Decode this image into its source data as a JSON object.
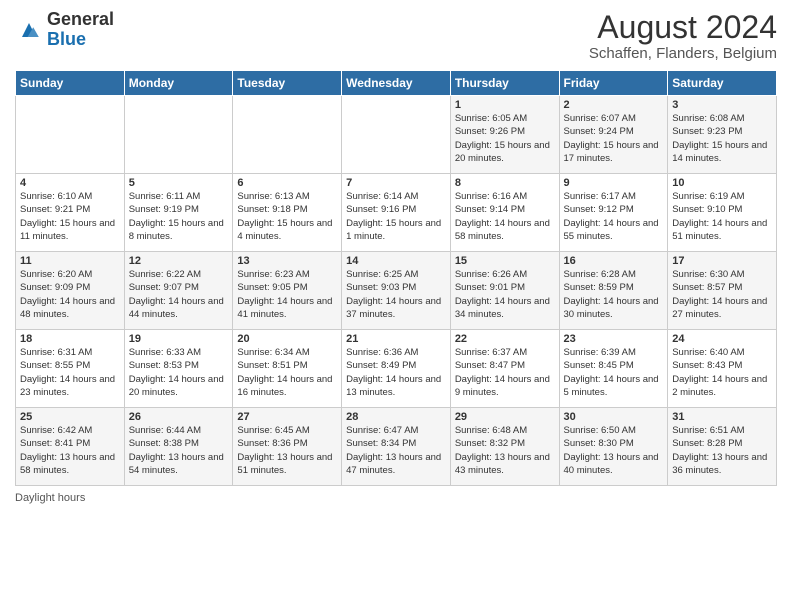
{
  "header": {
    "logo_general": "General",
    "logo_blue": "Blue",
    "month_year": "August 2024",
    "location": "Schaffen, Flanders, Belgium"
  },
  "days_of_week": [
    "Sunday",
    "Monday",
    "Tuesday",
    "Wednesday",
    "Thursday",
    "Friday",
    "Saturday"
  ],
  "weeks": [
    [
      {
        "day": "",
        "sunrise": "",
        "sunset": "",
        "daylight": ""
      },
      {
        "day": "",
        "sunrise": "",
        "sunset": "",
        "daylight": ""
      },
      {
        "day": "",
        "sunrise": "",
        "sunset": "",
        "daylight": ""
      },
      {
        "day": "",
        "sunrise": "",
        "sunset": "",
        "daylight": ""
      },
      {
        "day": "1",
        "sunrise": "Sunrise: 6:05 AM",
        "sunset": "Sunset: 9:26 PM",
        "daylight": "Daylight: 15 hours and 20 minutes."
      },
      {
        "day": "2",
        "sunrise": "Sunrise: 6:07 AM",
        "sunset": "Sunset: 9:24 PM",
        "daylight": "Daylight: 15 hours and 17 minutes."
      },
      {
        "day": "3",
        "sunrise": "Sunrise: 6:08 AM",
        "sunset": "Sunset: 9:23 PM",
        "daylight": "Daylight: 15 hours and 14 minutes."
      }
    ],
    [
      {
        "day": "4",
        "sunrise": "Sunrise: 6:10 AM",
        "sunset": "Sunset: 9:21 PM",
        "daylight": "Daylight: 15 hours and 11 minutes."
      },
      {
        "day": "5",
        "sunrise": "Sunrise: 6:11 AM",
        "sunset": "Sunset: 9:19 PM",
        "daylight": "Daylight: 15 hours and 8 minutes."
      },
      {
        "day": "6",
        "sunrise": "Sunrise: 6:13 AM",
        "sunset": "Sunset: 9:18 PM",
        "daylight": "Daylight: 15 hours and 4 minutes."
      },
      {
        "day": "7",
        "sunrise": "Sunrise: 6:14 AM",
        "sunset": "Sunset: 9:16 PM",
        "daylight": "Daylight: 15 hours and 1 minute."
      },
      {
        "day": "8",
        "sunrise": "Sunrise: 6:16 AM",
        "sunset": "Sunset: 9:14 PM",
        "daylight": "Daylight: 14 hours and 58 minutes."
      },
      {
        "day": "9",
        "sunrise": "Sunrise: 6:17 AM",
        "sunset": "Sunset: 9:12 PM",
        "daylight": "Daylight: 14 hours and 55 minutes."
      },
      {
        "day": "10",
        "sunrise": "Sunrise: 6:19 AM",
        "sunset": "Sunset: 9:10 PM",
        "daylight": "Daylight: 14 hours and 51 minutes."
      }
    ],
    [
      {
        "day": "11",
        "sunrise": "Sunrise: 6:20 AM",
        "sunset": "Sunset: 9:09 PM",
        "daylight": "Daylight: 14 hours and 48 minutes."
      },
      {
        "day": "12",
        "sunrise": "Sunrise: 6:22 AM",
        "sunset": "Sunset: 9:07 PM",
        "daylight": "Daylight: 14 hours and 44 minutes."
      },
      {
        "day": "13",
        "sunrise": "Sunrise: 6:23 AM",
        "sunset": "Sunset: 9:05 PM",
        "daylight": "Daylight: 14 hours and 41 minutes."
      },
      {
        "day": "14",
        "sunrise": "Sunrise: 6:25 AM",
        "sunset": "Sunset: 9:03 PM",
        "daylight": "Daylight: 14 hours and 37 minutes."
      },
      {
        "day": "15",
        "sunrise": "Sunrise: 6:26 AM",
        "sunset": "Sunset: 9:01 PM",
        "daylight": "Daylight: 14 hours and 34 minutes."
      },
      {
        "day": "16",
        "sunrise": "Sunrise: 6:28 AM",
        "sunset": "Sunset: 8:59 PM",
        "daylight": "Daylight: 14 hours and 30 minutes."
      },
      {
        "day": "17",
        "sunrise": "Sunrise: 6:30 AM",
        "sunset": "Sunset: 8:57 PM",
        "daylight": "Daylight: 14 hours and 27 minutes."
      }
    ],
    [
      {
        "day": "18",
        "sunrise": "Sunrise: 6:31 AM",
        "sunset": "Sunset: 8:55 PM",
        "daylight": "Daylight: 14 hours and 23 minutes."
      },
      {
        "day": "19",
        "sunrise": "Sunrise: 6:33 AM",
        "sunset": "Sunset: 8:53 PM",
        "daylight": "Daylight: 14 hours and 20 minutes."
      },
      {
        "day": "20",
        "sunrise": "Sunrise: 6:34 AM",
        "sunset": "Sunset: 8:51 PM",
        "daylight": "Daylight: 14 hours and 16 minutes."
      },
      {
        "day": "21",
        "sunrise": "Sunrise: 6:36 AM",
        "sunset": "Sunset: 8:49 PM",
        "daylight": "Daylight: 14 hours and 13 minutes."
      },
      {
        "day": "22",
        "sunrise": "Sunrise: 6:37 AM",
        "sunset": "Sunset: 8:47 PM",
        "daylight": "Daylight: 14 hours and 9 minutes."
      },
      {
        "day": "23",
        "sunrise": "Sunrise: 6:39 AM",
        "sunset": "Sunset: 8:45 PM",
        "daylight": "Daylight: 14 hours and 5 minutes."
      },
      {
        "day": "24",
        "sunrise": "Sunrise: 6:40 AM",
        "sunset": "Sunset: 8:43 PM",
        "daylight": "Daylight: 14 hours and 2 minutes."
      }
    ],
    [
      {
        "day": "25",
        "sunrise": "Sunrise: 6:42 AM",
        "sunset": "Sunset: 8:41 PM",
        "daylight": "Daylight: 13 hours and 58 minutes."
      },
      {
        "day": "26",
        "sunrise": "Sunrise: 6:44 AM",
        "sunset": "Sunset: 8:38 PM",
        "daylight": "Daylight: 13 hours and 54 minutes."
      },
      {
        "day": "27",
        "sunrise": "Sunrise: 6:45 AM",
        "sunset": "Sunset: 8:36 PM",
        "daylight": "Daylight: 13 hours and 51 minutes."
      },
      {
        "day": "28",
        "sunrise": "Sunrise: 6:47 AM",
        "sunset": "Sunset: 8:34 PM",
        "daylight": "Daylight: 13 hours and 47 minutes."
      },
      {
        "day": "29",
        "sunrise": "Sunrise: 6:48 AM",
        "sunset": "Sunset: 8:32 PM",
        "daylight": "Daylight: 13 hours and 43 minutes."
      },
      {
        "day": "30",
        "sunrise": "Sunrise: 6:50 AM",
        "sunset": "Sunset: 8:30 PM",
        "daylight": "Daylight: 13 hours and 40 minutes."
      },
      {
        "day": "31",
        "sunrise": "Sunrise: 6:51 AM",
        "sunset": "Sunset: 8:28 PM",
        "daylight": "Daylight: 13 hours and 36 minutes."
      }
    ]
  ],
  "footer": {
    "label": "Daylight hours"
  }
}
